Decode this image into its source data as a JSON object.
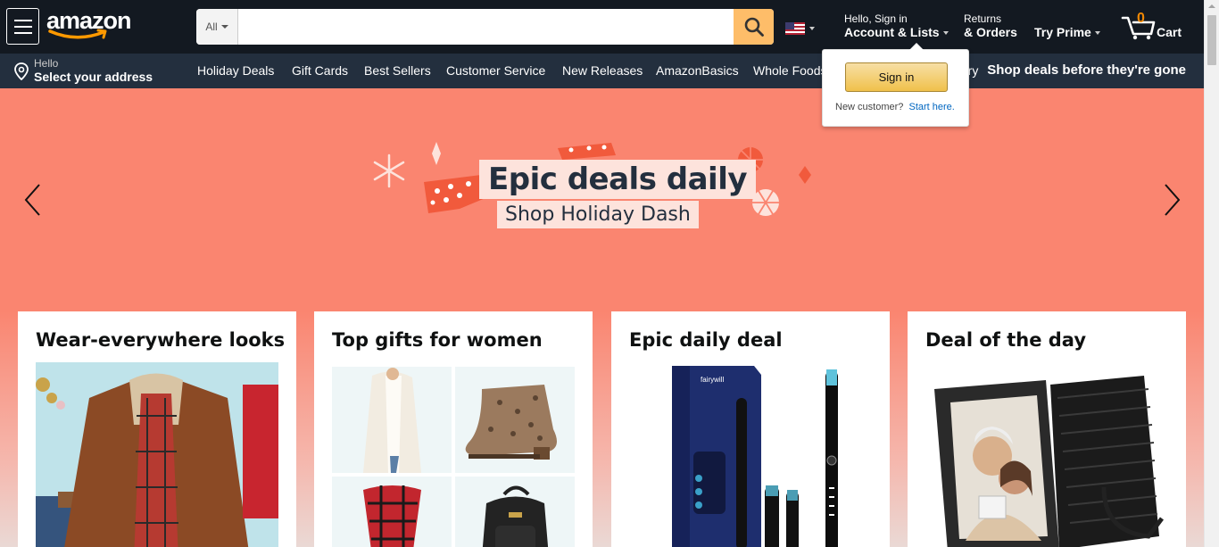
{
  "header": {
    "logo_text": "amazon",
    "search": {
      "category": "All",
      "placeholder": "",
      "value": ""
    },
    "account": {
      "line1": "Hello, Sign in",
      "line2": "Account & Lists"
    },
    "returns": {
      "line1": "Returns",
      "line2": "& Orders"
    },
    "prime": {
      "label": "Try Prime"
    },
    "cart": {
      "count": "0",
      "label": "Cart"
    }
  },
  "subnav": {
    "address": {
      "line1": "Hello",
      "line2": "Select your address"
    },
    "links": [
      "Holiday Deals",
      "Gift Cards",
      "Best Sellers",
      "Customer Service",
      "New Releases",
      "AmazonBasics",
      "Whole Foods",
      "Registry"
    ],
    "promo": "Shop deals before they're gone"
  },
  "hero": {
    "title": "Epic deals daily",
    "subtitle": "Shop Holiday Dash",
    "colors": {
      "background": "#fa8570",
      "accent": "#f15a3c"
    }
  },
  "cards": [
    {
      "title": "Wear-everywhere looks"
    },
    {
      "title": "Top gifts for women"
    },
    {
      "title": "Epic daily deal"
    },
    {
      "title": "Deal of the day"
    }
  ],
  "flyout": {
    "button": "Sign in",
    "new_customer": "New customer?",
    "start_here": "Start here."
  },
  "colors": {
    "nav_bg": "#131921",
    "subnav_bg": "#232f3e",
    "search_button": "#febd69",
    "cart_count": "#f08804",
    "link": "#0066c0"
  }
}
